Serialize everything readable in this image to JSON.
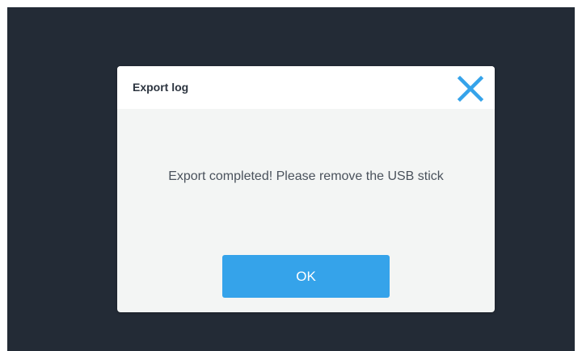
{
  "dialog": {
    "title": "Export log",
    "message": "Export completed! Please remove the USB stick",
    "ok_label": "OK",
    "close_icon": "close-icon"
  },
  "colors": {
    "backdrop": "#232b36",
    "dialog_body": "#f3f5f4",
    "header": "#ffffff",
    "accent": "#35a3ea",
    "title_text": "#2d3540",
    "message_text": "#4a525c"
  }
}
